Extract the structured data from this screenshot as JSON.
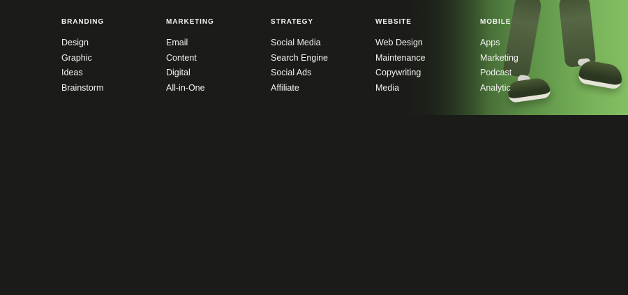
{
  "footer": {
    "columns": [
      {
        "heading": "BRANDING",
        "links": [
          "Design",
          "Graphic",
          "Ideas",
          "Brainstorm"
        ]
      },
      {
        "heading": "MARKETING",
        "links": [
          "Email",
          "Content",
          "Digital",
          "All-in-One"
        ]
      },
      {
        "heading": "STRATEGY",
        "links": [
          "Social Media",
          "Search Engine",
          "Social Ads",
          "Affiliate"
        ]
      },
      {
        "heading": "WEBSITE",
        "links": [
          "Web Design",
          "Maintenance",
          "Copywriting",
          "Media"
        ]
      },
      {
        "heading": "MOBILE",
        "links": [
          "Apps",
          "Marketing",
          "Podcast",
          "Analytic"
        ]
      }
    ]
  },
  "colors": {
    "background": "#1b1c19",
    "text": "#f1f2ed",
    "photo_green": "#7ab65b"
  }
}
